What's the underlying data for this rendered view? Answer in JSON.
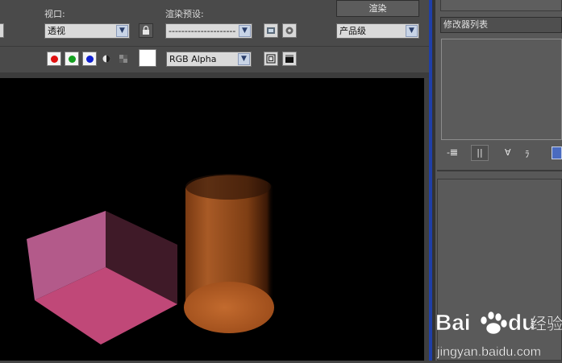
{
  "toolbar": {
    "viewport_label": "视口:",
    "viewport_value": "透视",
    "render_preset_label": "渲染预设:",
    "render_preset_value": "---------------------",
    "render_button": "渲染",
    "quality_value": "产品级",
    "channel_value": "RGB Alpha"
  },
  "command_panel": {
    "modifier_list_label": "修改器列表"
  },
  "scene": {
    "box_color_top": "#c04878",
    "box_color_left": "#b35a8a",
    "box_color_right": "#3f1a28",
    "cylinder_color": "#c0632a"
  },
  "watermark": {
    "brand": "Bai",
    "brand2": "du",
    "suffix": "经验",
    "url": "jingyan.baidu.com"
  }
}
